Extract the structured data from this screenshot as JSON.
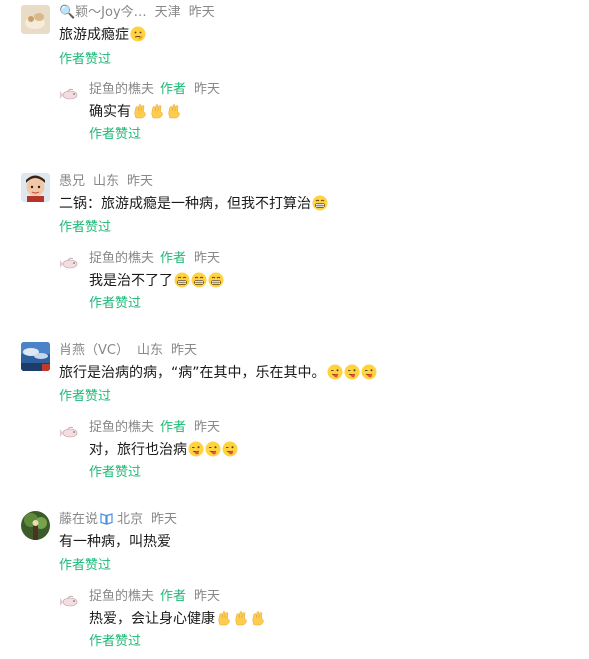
{
  "threads": [
    {
      "user": "🔍颖～Joy今…",
      "location": "天津",
      "time": "昨天",
      "text": "旅游成瘾症",
      "liked": "作者赞过",
      "reply": {
        "user": "捉鱼的樵夫",
        "tag": "作者",
        "time": "昨天",
        "text": "确实有",
        "liked": "作者赞过"
      }
    },
    {
      "user": "愚兄",
      "location": "山东",
      "time": "昨天",
      "text": "二锅：旅游成瘾是一种病，但我不打算治",
      "liked": "作者赞过",
      "reply": {
        "user": "捉鱼的樵夫",
        "tag": "作者",
        "time": "昨天",
        "text": "我是治不了了",
        "liked": "作者赞过"
      }
    },
    {
      "user": "肖燕（VC）",
      "location": "山东",
      "time": "昨天",
      "text": "旅行是治病的病，“病”在其中，乐在其中。",
      "liked": "作者赞过",
      "reply": {
        "user": "捉鱼的樵夫",
        "tag": "作者",
        "time": "昨天",
        "text": "对，旅行也治病",
        "liked": "作者赞过"
      }
    },
    {
      "user": "藤在说",
      "location": "北京",
      "time": "昨天",
      "text": "有一种病，叫热爱",
      "liked": "作者赞过",
      "reply": {
        "user": "捉鱼的樵夫",
        "tag": "作者",
        "time": "昨天",
        "text": "热爱，会让身心健康",
        "liked": "作者赞过"
      }
    }
  ]
}
